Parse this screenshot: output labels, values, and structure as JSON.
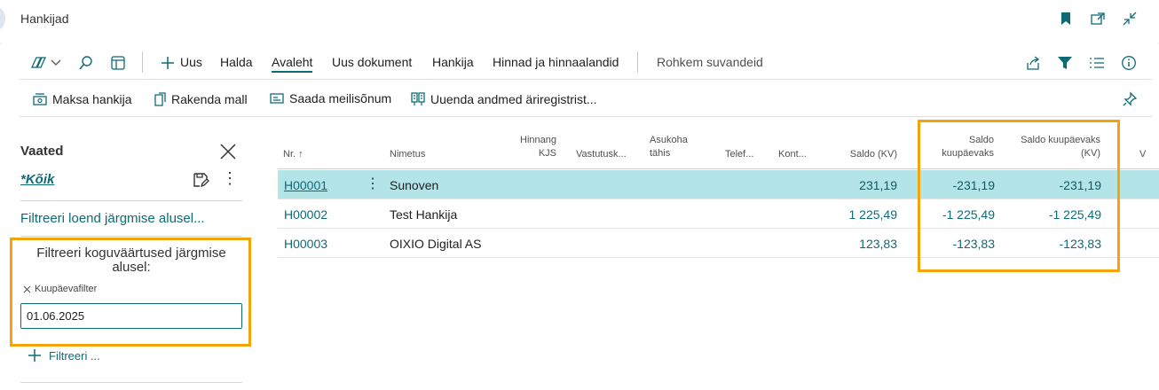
{
  "window": {
    "title": "Hankijad"
  },
  "actions": {
    "new": "Uus",
    "manage": "Halda",
    "home": "Avaleht",
    "new_document": "Uus dokument",
    "vendor": "Hankija",
    "prices": "Hinnad ja hinnaalandid",
    "more": "Rohkem suvandeid"
  },
  "actions2": {
    "pay_vendor": "Maksa hankija",
    "apply_template": "Rakenda mall",
    "send_email": "Saada meilisõnum",
    "update_registry": "Uuenda andmed äriregistrist..."
  },
  "views": {
    "title": "Vaated",
    "all": "*Kõik",
    "filter_list": "Filtreeri loend järgmise alusel...",
    "filter_totals": "Filtreeri koguväärtused järgmise alusel:",
    "date_filter_label": "Kuupäevafilter",
    "date_filter_value": "01.06.2025",
    "add_filter": "Filtreeri ..."
  },
  "table": {
    "columns": {
      "no": "Nr. ↑",
      "name": "Nimetus",
      "price_vat": "Hinnang KJS",
      "responsible": "Vastutusk...",
      "location": "Asukoha tähis",
      "phone": "Telef...",
      "contact": "Kont...",
      "balance_lcy": "Saldo (KV)",
      "balance_date": "Saldo kuupäevaks",
      "balance_date_lcy": "Saldo kuupäevaks (KV)",
      "extra": "V"
    },
    "rows": [
      {
        "no": "H00001",
        "name": "Sunoven",
        "balance_lcy": "231,19",
        "balance_date": "-231,19",
        "balance_date_lcy": "-231,19"
      },
      {
        "no": "H00002",
        "name": "Test Hankija",
        "balance_lcy": "1 225,49",
        "balance_date": "-1 225,49",
        "balance_date_lcy": "-1 225,49"
      },
      {
        "no": "H00003",
        "name": "OIXIO Digital AS",
        "balance_lcy": "123,83",
        "balance_date": "-123,83",
        "balance_date_lcy": "-123,83"
      }
    ]
  },
  "colors": {
    "accent": "#0e6b75",
    "highlight": "#f5a30a",
    "selected_row": "#b3e4e8"
  }
}
